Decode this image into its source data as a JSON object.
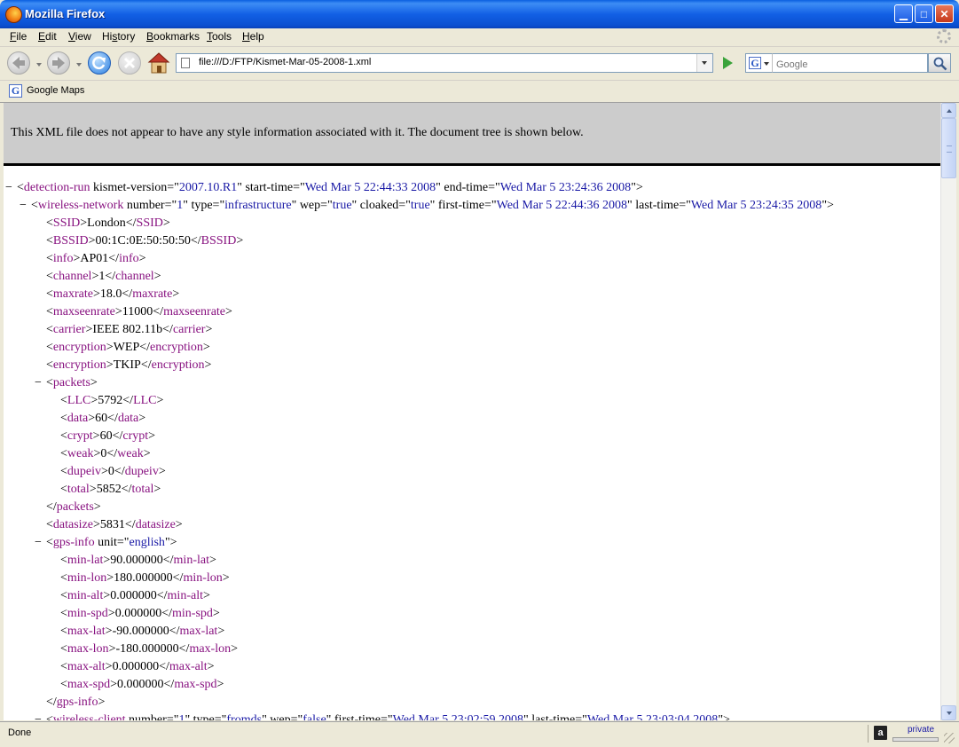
{
  "window": {
    "title": "Mozilla Firefox"
  },
  "menu": {
    "items": [
      {
        "accel": "F",
        "rest": "ile"
      },
      {
        "accel": "E",
        "rest": "dit"
      },
      {
        "accel": "V",
        "rest": "iew"
      },
      {
        "accel": "",
        "pre": "Hi",
        "mid": "s",
        "rest": "tory"
      },
      {
        "accel": "B",
        "rest": "ookmarks"
      },
      {
        "accel": "T",
        "rest": "ools"
      },
      {
        "accel": "H",
        "rest": "elp"
      }
    ]
  },
  "nav": {
    "url": "file:///D:/FTP/Kismet-Mar-05-2008-1.xml",
    "search_placeholder": "Google",
    "search_engine_letter": "G"
  },
  "bookmarks": {
    "items": [
      {
        "label": "Google Maps",
        "icon": "google-g-icon"
      }
    ]
  },
  "content": {
    "banner": "This XML file does not appear to have any style information associated with it. The document tree is shown below."
  },
  "xml": {
    "root_tag": "detection-run",
    "root_attrs": [
      {
        "name": "kismet-version",
        "value": "2007.10.R1"
      },
      {
        "name": "start-time",
        "value": "Wed Mar 5 22:44:33 2008"
      },
      {
        "name": "end-time",
        "value": "Wed Mar 5 23:24:36 2008"
      }
    ],
    "network_tag": "wireless-network",
    "network_attrs": [
      {
        "name": "number",
        "value": "1"
      },
      {
        "name": "type",
        "value": "infrastructure"
      },
      {
        "name": "wep",
        "value": "true"
      },
      {
        "name": "cloaked",
        "value": "true"
      },
      {
        "name": "first-time",
        "value": "Wed Mar 5 22:44:36 2008"
      },
      {
        "name": "last-time",
        "value": "Wed Mar 5 23:24:35 2008"
      }
    ],
    "network_fields": [
      {
        "tag": "SSID",
        "text": "London"
      },
      {
        "tag": "BSSID",
        "text": "00:1C:0E:50:50:50"
      },
      {
        "tag": "info",
        "text": "AP01"
      },
      {
        "tag": "channel",
        "text": "1"
      },
      {
        "tag": "maxrate",
        "text": "18.0"
      },
      {
        "tag": "maxseenrate",
        "text": "11000"
      },
      {
        "tag": "carrier",
        "text": "IEEE 802.11b"
      },
      {
        "tag": "encryption",
        "text": "WEP"
      },
      {
        "tag": "encryption",
        "text": "TKIP"
      }
    ],
    "packets_tag": "packets",
    "packets": [
      {
        "tag": "LLC",
        "text": "5792"
      },
      {
        "tag": "data",
        "text": "60"
      },
      {
        "tag": "crypt",
        "text": "60"
      },
      {
        "tag": "weak",
        "text": "0"
      },
      {
        "tag": "dupeiv",
        "text": "0"
      },
      {
        "tag": "total",
        "text": "5852"
      }
    ],
    "datasize": {
      "tag": "datasize",
      "text": "5831"
    },
    "gps_tag": "gps-info",
    "gps_attr": {
      "name": "unit",
      "value": "english"
    },
    "gps": [
      {
        "tag": "min-lat",
        "text": "90.000000"
      },
      {
        "tag": "min-lon",
        "text": "180.000000"
      },
      {
        "tag": "min-alt",
        "text": "0.000000"
      },
      {
        "tag": "min-spd",
        "text": "0.000000"
      },
      {
        "tag": "max-lat",
        "text": "-90.000000"
      },
      {
        "tag": "max-lon",
        "text": "-180.000000"
      },
      {
        "tag": "max-alt",
        "text": "0.000000"
      },
      {
        "tag": "max-spd",
        "text": "0.000000"
      }
    ],
    "client_tag": "wireless-client",
    "client_attrs": [
      {
        "name": "number",
        "value": "1"
      },
      {
        "name": "type",
        "value": "fromds"
      },
      {
        "name": "wep",
        "value": "false"
      },
      {
        "name": "first-time",
        "value": "Wed Mar 5 23:02:59 2008"
      },
      {
        "name": "last-time",
        "value": "Wed Mar 5 23:03:04 2008"
      }
    ]
  },
  "status": {
    "text": "Done",
    "private_label": "private"
  }
}
